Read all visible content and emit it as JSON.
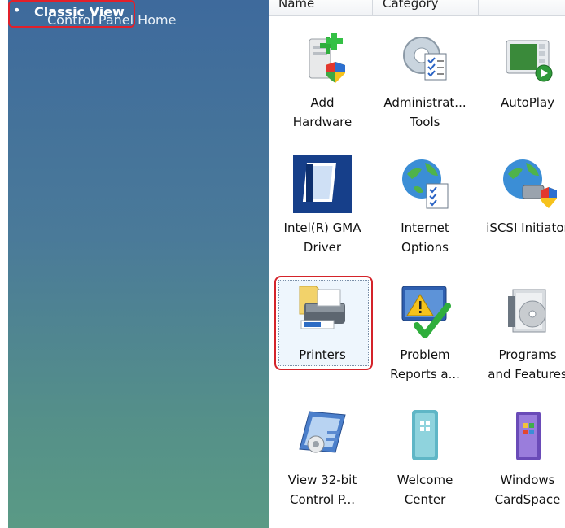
{
  "nav": {
    "home_label": "Control Panel Home",
    "bullet": "•",
    "classic_label": "Classic View"
  },
  "columns": {
    "name": "Name",
    "category": "Category"
  },
  "items": [
    {
      "line1": "Add",
      "line2": "Hardware",
      "icon": "add-hardware-icon"
    },
    {
      "line1": "Administrat...",
      "line2": "Tools",
      "icon": "administrative-tools-icon"
    },
    {
      "line1": "AutoPlay",
      "line2": "",
      "icon": "autoplay-icon"
    },
    {
      "line1": "Intel(R) GMA",
      "line2": "Driver",
      "icon": "intel-gma-driver-icon"
    },
    {
      "line1": "Internet",
      "line2": "Options",
      "icon": "internet-options-icon"
    },
    {
      "line1": "iSCSI Initiator",
      "line2": "",
      "icon": "iscsi-initiator-icon"
    },
    {
      "line1": "Printers",
      "line2": "",
      "icon": "printers-icon",
      "selected": true
    },
    {
      "line1": "Problem",
      "line2": "Reports a...",
      "icon": "problem-reports-icon"
    },
    {
      "line1": "Programs",
      "line2": "and Features",
      "icon": "programs-features-icon"
    },
    {
      "line1": "View 32-bit",
      "line2": "Control P...",
      "icon": "view-32bit-control-panel-icon"
    },
    {
      "line1": "Welcome",
      "line2": "Center",
      "icon": "welcome-center-icon"
    },
    {
      "line1": "Windows",
      "line2": "CardSpace",
      "icon": "windows-cardspace-icon"
    }
  ],
  "colors": {
    "highlight": "#e2202a",
    "nav_top": "#3e6a9c",
    "nav_bottom": "#5a9a85"
  }
}
